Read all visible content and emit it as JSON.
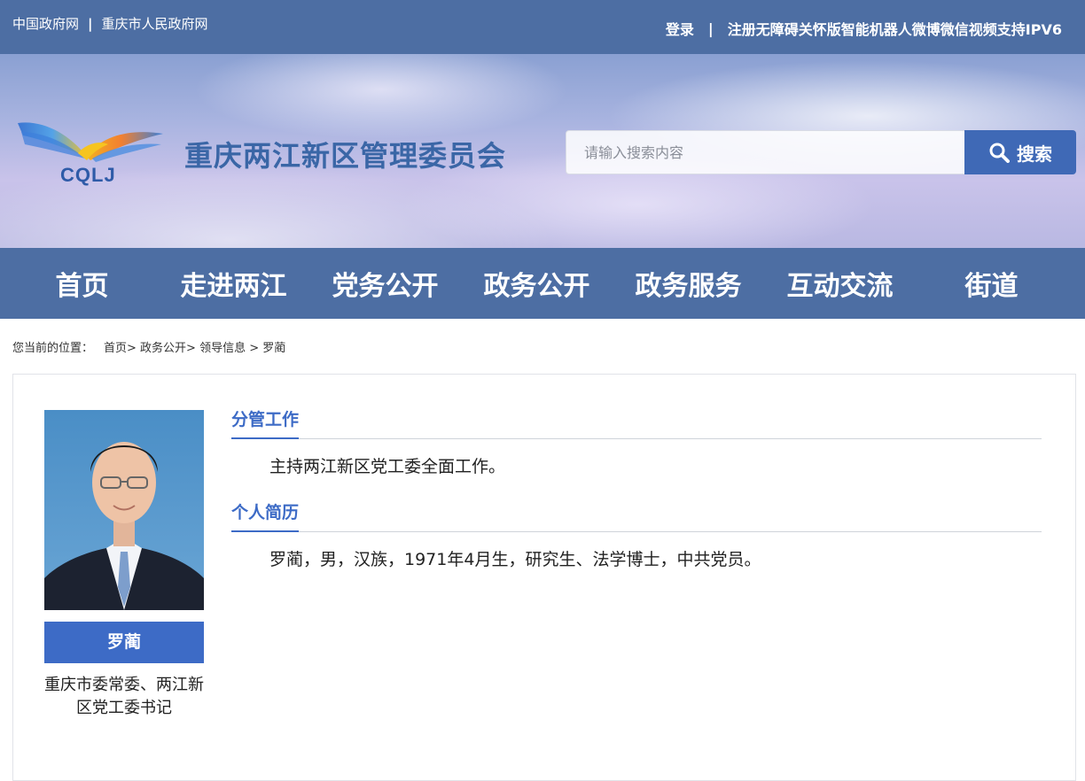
{
  "topbar": {
    "links_left": [
      "中国政府网",
      "重庆市人民政府网"
    ],
    "separator": "|",
    "login": "登录",
    "register": "注册",
    "links_right": [
      "无障碍",
      "关怀版",
      "智能机器人",
      "微博",
      "微信",
      "视频",
      "支持IPV6"
    ]
  },
  "banner": {
    "logo_text": "CQLJ",
    "site_title": "重庆两江新区管理委员会",
    "search_placeholder": "请输入搜索内容",
    "search_button": "搜索"
  },
  "nav": [
    "首页",
    "走进两江",
    "党务公开",
    "政务公开",
    "政务服务",
    "互动交流",
    "街道"
  ],
  "breadcrumb": {
    "label": "您当前的位置：",
    "path": "首页> 政务公开> 领导信息 > 罗蔺"
  },
  "profile": {
    "name": "罗蔺",
    "title": "重庆市委常委、两江新区党工委书记",
    "sections": [
      {
        "heading": "分管工作",
        "text": "主持两江新区党工委全面工作。"
      },
      {
        "heading": "个人简历",
        "text": "罗蔺，男，汉族，1971年4月生，研究生、法学博士，中共党员。"
      }
    ]
  },
  "colors": {
    "topbar": "#4d6ea3",
    "accent": "#3d6bc6",
    "search_button": "#3f69b6"
  }
}
